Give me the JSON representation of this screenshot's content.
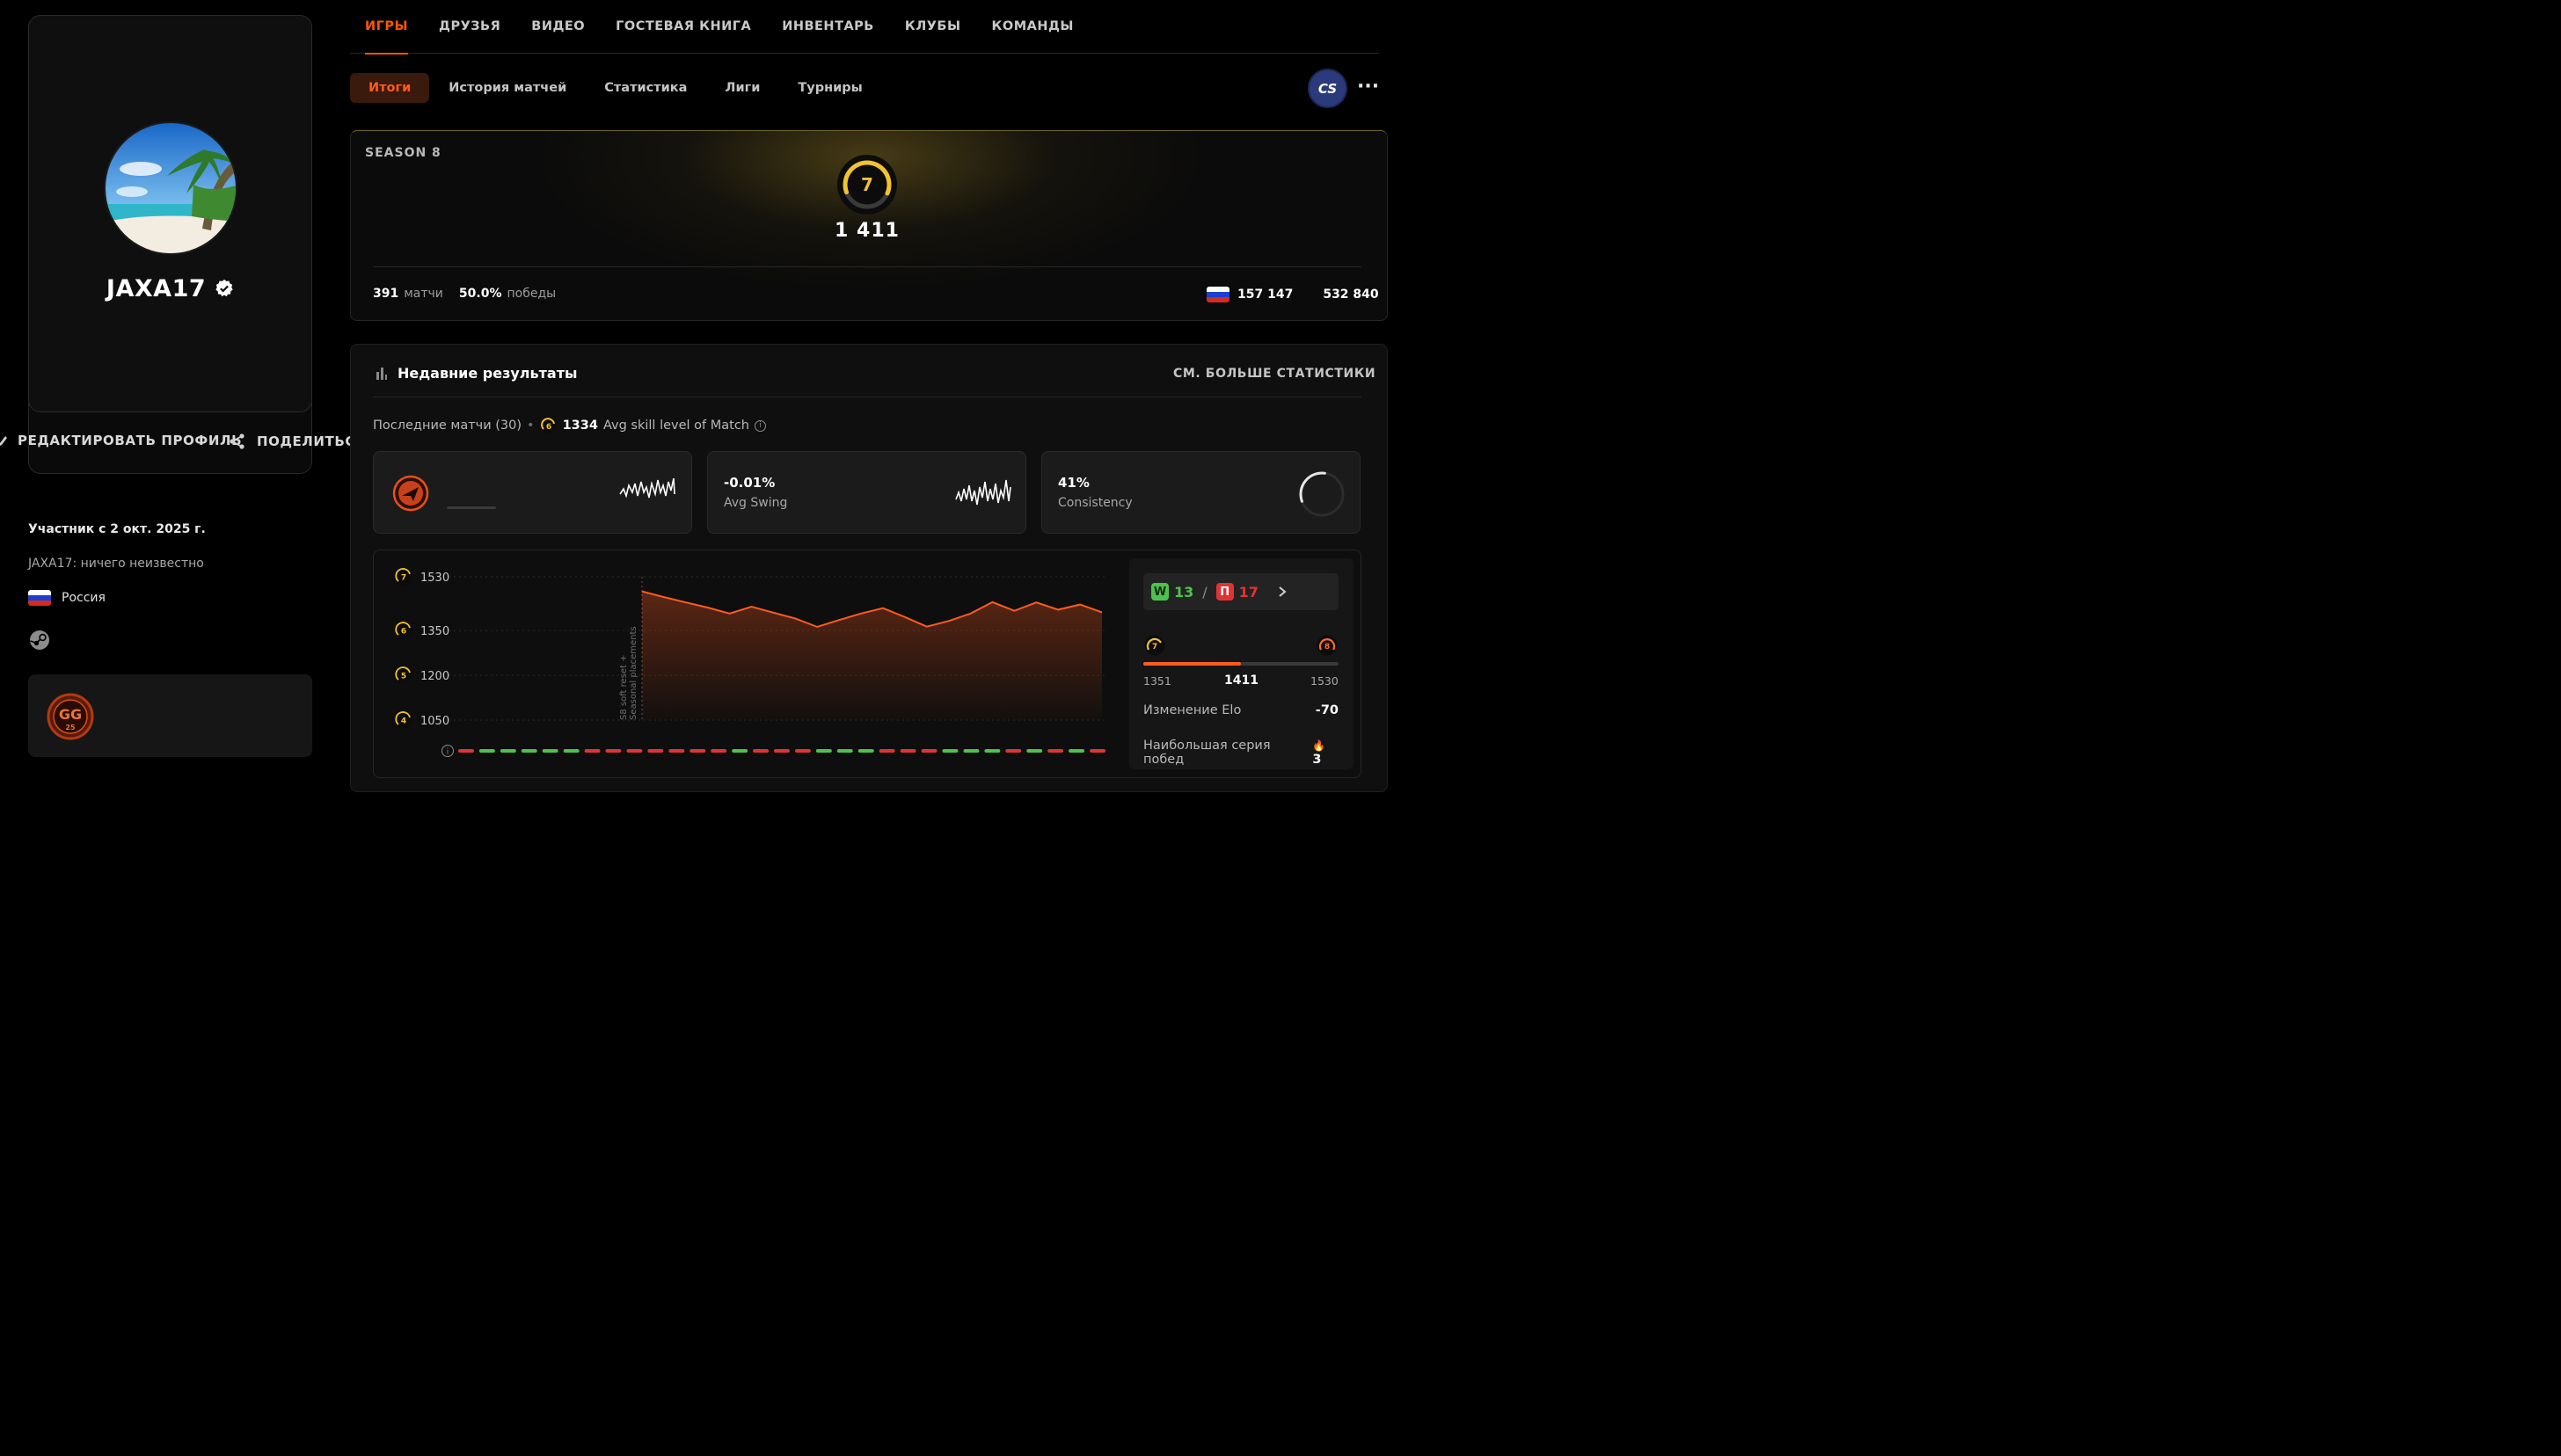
{
  "profile": {
    "nickname": "JAXA17",
    "edit_label": "РЕДАКТИРОВАТЬ ПРОФИЛЬ",
    "share_label": "ПОДЕЛИТЬСЯ",
    "member_since": "Участник с 2 окт. 2025 г.",
    "bio": "JAXA17: ничего неизвестно",
    "country": "Россия",
    "badge_text": "GG",
    "badge_sub": "25"
  },
  "top_tabs": [
    "ИГРЫ",
    "ДРУЗЬЯ",
    "ВИДЕО",
    "ГОСТЕВАЯ КНИГА",
    "ИНВЕНТАРЬ",
    "КЛУБЫ",
    "КОМАНДЫ"
  ],
  "sub_tabs": [
    "Итоги",
    "История матчей",
    "Статистика",
    "Лиги",
    "Турниры"
  ],
  "game_icon": "CS",
  "more_label": "···",
  "season": {
    "label": "SEASON 8",
    "level": "7",
    "level_progress": 0.62,
    "elo": "1 411",
    "matches_value": "391",
    "matches_label": "матчи",
    "winrate_value": "50.0%",
    "winrate_label": "победы",
    "country_rank": "157 147",
    "world_rank": "532 840"
  },
  "recent": {
    "title": "Недавние результаты",
    "see_more": "СМ. БОЛЬШЕ СТАТИСТИКИ",
    "last_matches_label": "Последние матчи (30)",
    "avg_level": "6",
    "avg_elo": "1334",
    "avg_label": "Avg skill level of Match",
    "stats": [
      {
        "value": "",
        "label": ""
      },
      {
        "value": "-0.01%",
        "label": "Avg Swing"
      },
      {
        "value": "41%",
        "label": "Consistency"
      }
    ],
    "consistency_fraction": 0.41
  },
  "chart_data": {
    "type": "area",
    "y_ticks": [
      {
        "level": "7",
        "value": 1530
      },
      {
        "level": "6",
        "value": 1350
      },
      {
        "level": "5",
        "value": 1200
      },
      {
        "level": "4",
        "value": 1050
      }
    ],
    "ylim": [
      1050,
      1530
    ],
    "annotation": "S8 soft reset + Seasonal placements",
    "series": [
      {
        "values": [
          1481,
          1462,
          1444,
          1427,
          1407,
          1430,
          1410,
          1390,
          1362,
          1385,
          1407,
          1425,
          1395,
          1363,
          1382,
          1407,
          1445,
          1416,
          1444,
          1420,
          1437,
          1411
        ]
      }
    ],
    "results": [
      "L",
      "W",
      "W",
      "W",
      "W",
      "W",
      "L",
      "L",
      "L",
      "L",
      "L",
      "L",
      "L",
      "W",
      "L",
      "L",
      "L",
      "W",
      "W",
      "W",
      "L",
      "L",
      "L",
      "W",
      "W",
      "W",
      "L",
      "W",
      "L",
      "W",
      "L"
    ]
  },
  "summary": {
    "wins": "13",
    "losses": "17",
    "win_letter": "W",
    "loss_letter": "П",
    "separator": "/",
    "cur_level": "7",
    "next_level": "8",
    "range_min": "1351",
    "range_cur": "1411",
    "range_max": "1530",
    "elo_progress": 0.5,
    "elo_change_label": "Изменение Elo",
    "elo_change_value": "-70",
    "streak_label": "Наибольшая серия побед",
    "streak_value": "3"
  },
  "colors": {
    "accent": "#ff5500",
    "win": "#4ec24e",
    "loss": "#e03434",
    "level": "#f2c230"
  }
}
